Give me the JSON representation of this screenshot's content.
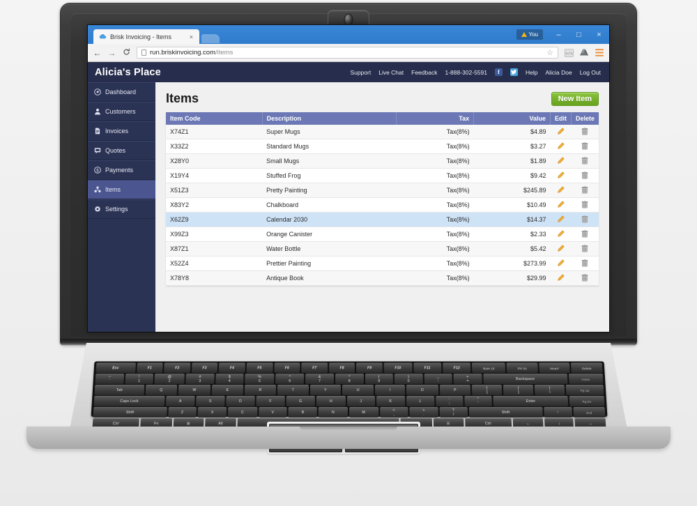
{
  "browser": {
    "tab": {
      "title": "Brisk Invoicing - Items",
      "favicon": "cloud-icon",
      "close": "×"
    },
    "window": {
      "user_badge": "You",
      "minimize": "–",
      "maximize": "□",
      "close": "×"
    },
    "toolbar": {
      "back": "←",
      "forward": "→",
      "reload": "⟳",
      "url_host": "run.briskinvoicing.com",
      "url_path": "/items",
      "bookmark_star": "☆",
      "code_icon": "</>",
      "drive_icon": "drive",
      "menu_icon": "☰"
    }
  },
  "app": {
    "brand": "Alicia's Place",
    "nav": [
      {
        "label": "Support",
        "name": "nav-support"
      },
      {
        "label": "Live Chat",
        "name": "nav-live-chat"
      },
      {
        "label": "Feedback",
        "name": "nav-feedback"
      },
      {
        "label": "1-888-302-5591",
        "name": "nav-phone"
      }
    ],
    "social": [
      {
        "name": "facebook-icon",
        "glyph": "f"
      },
      {
        "name": "twitter-icon",
        "glyph": "t"
      }
    ],
    "nav_right": [
      {
        "label": "Help",
        "name": "nav-help"
      },
      {
        "label": "Alicia Doe",
        "name": "nav-account"
      },
      {
        "label": "Log Out",
        "name": "nav-logout"
      }
    ],
    "sidebar": [
      {
        "label": "Dashboard",
        "icon": "dashboard-icon",
        "glyph": "⚙",
        "active": false
      },
      {
        "label": "Customers",
        "icon": "user-icon",
        "glyph": "♟",
        "active": false
      },
      {
        "label": "Invoices",
        "icon": "document-icon",
        "glyph": "▤",
        "active": false
      },
      {
        "label": "Quotes",
        "icon": "speech-icon",
        "glyph": "▣",
        "active": false
      },
      {
        "label": "Payments",
        "icon": "coin-icon",
        "glyph": "◎",
        "active": false
      },
      {
        "label": "Items",
        "icon": "items-icon",
        "glyph": "♣",
        "active": true
      },
      {
        "label": "Settings",
        "icon": "gear-icon",
        "glyph": "✲",
        "active": false
      }
    ],
    "page": {
      "title": "Items",
      "new_button": "New Item",
      "columns": [
        "Item Code",
        "Description",
        "Tax",
        "Value",
        "Edit",
        "Delete"
      ],
      "rows": [
        {
          "code": "X74Z1",
          "description": "Super Mugs",
          "tax": "Tax(8%)",
          "value": "$4.89",
          "selected": false
        },
        {
          "code": "X33Z2",
          "description": "Standard Mugs",
          "tax": "Tax(8%)",
          "value": "$3.27",
          "selected": false
        },
        {
          "code": "X28Y0",
          "description": "Small Mugs",
          "tax": "Tax(8%)",
          "value": "$1.89",
          "selected": false
        },
        {
          "code": "X19Y4",
          "description": "Stuffed Frog",
          "tax": "Tax(8%)",
          "value": "$9.42",
          "selected": false
        },
        {
          "code": "X51Z3",
          "description": "Pretty Painting",
          "tax": "Tax(8%)",
          "value": "$245.89",
          "selected": false
        },
        {
          "code": "X83Y2",
          "description": "Chalkboard",
          "tax": "Tax(8%)",
          "value": "$10.49",
          "selected": false
        },
        {
          "code": "X62Z9",
          "description": "Calendar 2030",
          "tax": "Tax(8%)",
          "value": "$14.37",
          "selected": true
        },
        {
          "code": "X99Z3",
          "description": "Orange Canister",
          "tax": "Tax(8%)",
          "value": "$2.33",
          "selected": false
        },
        {
          "code": "X87Z1",
          "description": "Water Bottle",
          "tax": "Tax(8%)",
          "value": "$5.42",
          "selected": false
        },
        {
          "code": "X52Z4",
          "description": "Prettier Painting",
          "tax": "Tax(8%)",
          "value": "$273.99",
          "selected": false
        },
        {
          "code": "X78Y8",
          "description": "Antique Book",
          "tax": "Tax(8%)",
          "value": "$29.99",
          "selected": false
        }
      ],
      "row_icons": {
        "edit": "pencil-icon",
        "delete": "trash-icon"
      }
    }
  },
  "keyboard": {
    "rows": [
      [
        "Esc",
        "F1",
        "F2",
        "F3",
        "F4",
        "F5",
        "F6",
        "F7",
        "F8",
        "F9",
        "F10",
        "F11",
        "F12",
        "Num Lk",
        "Prt Sc",
        "Insert",
        "Delete"
      ],
      [
        "~ `",
        "! 1",
        "@ 2",
        "# 3",
        "$ 4",
        "% 5",
        "^ 6",
        "& 7",
        "* 8",
        "( 9",
        ") 0",
        "_ -",
        "+ =",
        "Backspace",
        "Home"
      ],
      [
        "Tab",
        "Q",
        "W",
        "E",
        "R",
        "T",
        "Y",
        "U",
        "I",
        "O",
        "P",
        "{ [",
        "} ]",
        "| \\",
        "Pg Up"
      ],
      [
        "Caps Lock",
        "A",
        "S",
        "D",
        "F",
        "G",
        "H",
        "J",
        "K",
        "L",
        ": ;",
        "\" '",
        "Enter",
        "Pg Dn"
      ],
      [
        "Shift",
        "Z",
        "X",
        "C",
        "V",
        "B",
        "N",
        "M",
        "< ,",
        "> .",
        "? /",
        "Shift",
        "↑",
        "End"
      ],
      [
        "Ctrl",
        "Fn",
        "⊞",
        "Alt",
        "",
        "Alt",
        "☰",
        "Ctrl",
        "←",
        "↓",
        "→"
      ]
    ]
  },
  "colors": {
    "browser_blue": "#2f7ccd",
    "app_header_navy": "#272e4d",
    "sidebar_navy": "#2b3355",
    "sidebar_active": "#4b5590",
    "table_header": "#6b78b5",
    "row_selected": "#cfe3f7",
    "new_button_green": "#76b02b",
    "edit_icon_orange": "#f0a022",
    "delete_icon_gray": "#9a9a9a"
  }
}
